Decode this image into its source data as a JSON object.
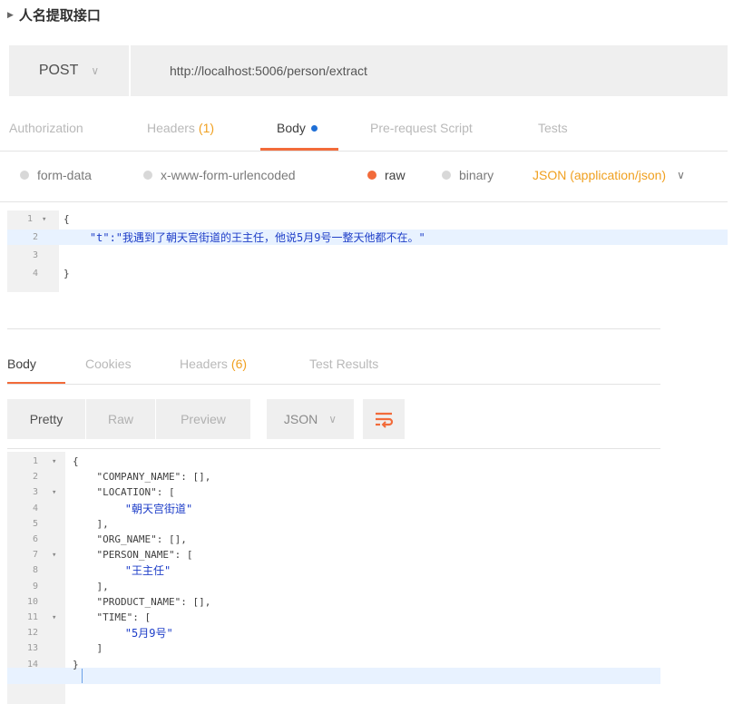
{
  "request": {
    "title": "人名提取接口",
    "method": "POST",
    "url": "http://localhost:5006/person/extract"
  },
  "request_tabs": [
    {
      "label": "Authorization",
      "count": ""
    },
    {
      "label": "Headers",
      "count": "(1)"
    },
    {
      "label": "Body",
      "count": ""
    },
    {
      "label": "Pre-request Script",
      "count": ""
    },
    {
      "label": "Tests",
      "count": ""
    }
  ],
  "body_types": [
    "form-data",
    "x-www-form-urlencoded",
    "raw",
    "binary"
  ],
  "content_type": "JSON (application/json)",
  "request_body": {
    "line_numbers": [
      "1",
      "2",
      "3",
      "4"
    ],
    "lines": [
      "{",
      "    \"t\":\"我遇到了朝天宫街道的王主任，他说5月9号一整天他都不在。\"",
      "",
      "}"
    ]
  },
  "response_tabs": [
    {
      "label": "Body",
      "count": ""
    },
    {
      "label": "Cookies",
      "count": ""
    },
    {
      "label": "Headers",
      "count": "(6)"
    },
    {
      "label": "Test Results",
      "count": ""
    }
  ],
  "view_modes": [
    "Pretty",
    "Raw",
    "Preview"
  ],
  "format": "JSON",
  "response_body": {
    "line_numbers": [
      "1",
      "2",
      "3",
      "4",
      "5",
      "6",
      "7",
      "8",
      "9",
      "10",
      "11",
      "12",
      "13",
      "14"
    ],
    "lines": [
      "{",
      "    \"COMPANY_NAME\": [],",
      "    \"LOCATION\": [",
      "        \"朝天宫街道\"",
      "    ],",
      "    \"ORG_NAME\": [],",
      "    \"PERSON_NAME\": [",
      "        \"王主任\"",
      "    ],",
      "    \"PRODUCT_NAME\": [],",
      "    \"TIME\": [",
      "        \"5月9号\"",
      "    ]",
      "}"
    ]
  },
  "colors": {
    "accent": "#f26b3a",
    "count": "#f0a020",
    "string": "#1e3ec8",
    "dot": "#1f6fd6"
  }
}
